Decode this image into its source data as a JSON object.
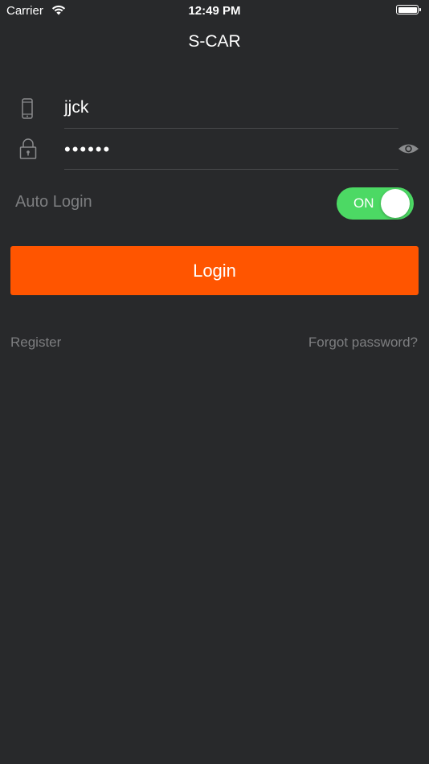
{
  "status_bar": {
    "carrier": "Carrier",
    "time": "12:49 PM"
  },
  "app": {
    "title": "S-CAR"
  },
  "form": {
    "username": {
      "value": "jjck",
      "icon": "phone-icon"
    },
    "password": {
      "value": "••••••",
      "icon": "lock-icon",
      "toggle_icon": "eye-icon"
    },
    "auto_login": {
      "label": "Auto Login",
      "toggle_label": "ON",
      "on": true
    },
    "login_button": "Login"
  },
  "links": {
    "register": "Register",
    "forgot_password": "Forgot password?"
  },
  "colors": {
    "background": "#28292b",
    "accent": "#ff5500",
    "toggle_on": "#4cd964",
    "muted_text": "#7d7e80"
  }
}
